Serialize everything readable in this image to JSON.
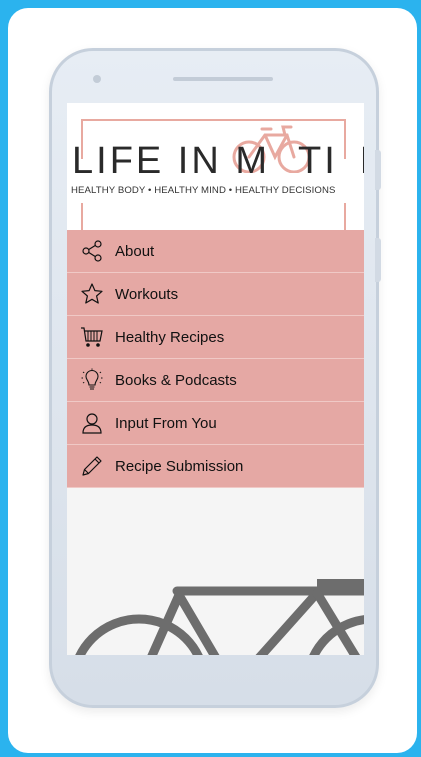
{
  "app": {
    "title_left": "LIFE IN M",
    "title_mid": "T",
    "title_i": "I",
    "title_right": "N",
    "tagline": "HEALTHY BODY • HEALTHY MIND • HEALTHY DECISIONS"
  },
  "menu": {
    "items": [
      {
        "label": "About",
        "icon": "share-icon"
      },
      {
        "label": "Workouts",
        "icon": "star-icon"
      },
      {
        "label": "Healthy Recipes",
        "icon": "cart-icon"
      },
      {
        "label": "Books & Podcasts",
        "icon": "lightbulb-icon"
      },
      {
        "label": "Input From You",
        "icon": "user-icon"
      },
      {
        "label": "Recipe Submission",
        "icon": "pencil-icon"
      }
    ]
  },
  "colors": {
    "background": "#2bb3ee",
    "menu_item": "#e5a8a4",
    "accent": "#e8a9a0",
    "bike_grey": "#6d6d6d"
  }
}
